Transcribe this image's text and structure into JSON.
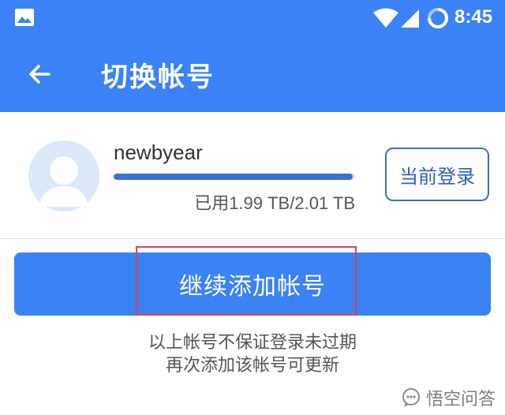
{
  "status_bar": {
    "time": "8:45",
    "icons": [
      "image-icon",
      "wifi-icon",
      "cell-signal-icon",
      "battery-ring-icon"
    ]
  },
  "toolbar": {
    "back_icon": "arrow-left-icon",
    "title": "切换帐号"
  },
  "account": {
    "avatar_icon": "default-avatar-icon",
    "username": "newbyear",
    "storage_used_fraction": 0.99,
    "storage_text": "已用1.99 TB/2.01 TB",
    "current_login_label": "当前登录"
  },
  "add_account_label": "继续添加帐号",
  "note_lines": [
    "以上帐号不保证登录未过期",
    "再次添加该帐号可更新"
  ],
  "watermark": {
    "icon": "chat-bubble-icon",
    "text": "悟空问答"
  },
  "colors": {
    "primary": "#3b82f6",
    "highlight": "#e0424a",
    "storage_fill": "#3b6fd4"
  }
}
